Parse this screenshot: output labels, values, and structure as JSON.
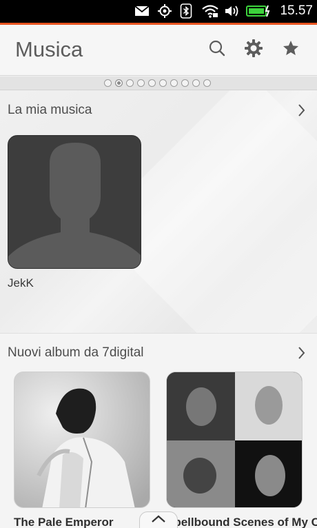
{
  "status_bar": {
    "time": "15.57",
    "icons": [
      "mail-icon",
      "location-icon",
      "bluetooth-icon",
      "wifi-icon",
      "volume-icon",
      "battery-charging-icon"
    ]
  },
  "header": {
    "title": "Musica",
    "actions": [
      "search-icon",
      "settings-icon",
      "favorite-star-icon"
    ]
  },
  "page_indicator": {
    "count": 10,
    "active_index": 1
  },
  "sections": {
    "my_music": {
      "title": "La mia musica",
      "artists": [
        {
          "name": "JekK",
          "icon": "person-silhouette-icon"
        }
      ]
    },
    "new_albums": {
      "title": "Nuovi album da 7digital",
      "albums": [
        {
          "title": "The Pale Emperor"
        },
        {
          "title": "Spellbound Scenes of My Cure"
        }
      ]
    }
  },
  "colors": {
    "accent": "#e95420",
    "status_bar": "#000000",
    "battery": "#3cd33c"
  }
}
